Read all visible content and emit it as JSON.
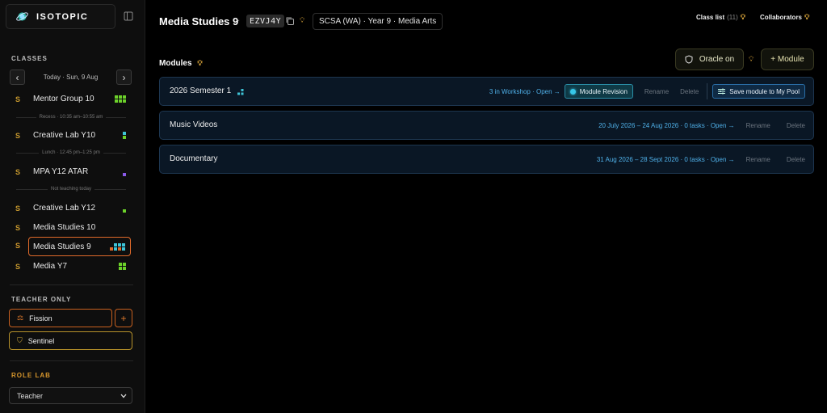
{
  "brand": {
    "name": "ISOTOPIC"
  },
  "sidebar": {
    "classes_title": "CLASSES",
    "day_label": "Today · Sun, 9 Aug",
    "prev_label": "‹",
    "next_label": "›",
    "classes": [
      {
        "badge": "S",
        "name": "Mentor Group 10"
      },
      {
        "badge": "S",
        "name": "Creative Lab Y10"
      },
      {
        "badge": "S",
        "name": "MPA Y12 ATAR"
      },
      {
        "badge": "S",
        "name": "Creative Lab Y12"
      },
      {
        "badge": "S",
        "name": "Media Studies 10"
      },
      {
        "badge": "S",
        "name": "Media Studies 9"
      },
      {
        "badge": "S",
        "name": "Media Y7"
      }
    ],
    "breaks": {
      "recess": "Recess · 10:35 am–10:55 am",
      "lunch": "Lunch · 12:45 pm–1:25 pm",
      "not_teaching": "Not teaching today"
    },
    "teacher_only_title": "TEACHER ONLY",
    "fission_label": "Fission",
    "plus_label": "+",
    "sentinel_label": "Sentinel",
    "role_lab_title": "ROLE LAB",
    "role_select_value": "Teacher"
  },
  "header": {
    "title": "Media Studies 9",
    "separator": "·",
    "class_code": "EZVJ4Y",
    "meta": "SCSA (WA) · Year 9 · Media Arts",
    "class_list_label": "Class list",
    "class_list_count": "(11)",
    "collaborators_label": "Collaborators"
  },
  "modules": {
    "title": "Modules",
    "oracle_label": "Oracle on",
    "add_module_label": "+ Module",
    "items": [
      {
        "name": "2026 Semester 1",
        "info": "3 in Workshop · Open →",
        "revision_label": "Module Revision",
        "rename_label": "Rename",
        "delete_label": "Delete",
        "save_label": "Save module to My Pool"
      },
      {
        "name": "Music Videos",
        "info": "20 July 2026 – 24 Aug 2026 · 0 tasks · Open →",
        "rename_label": "Rename",
        "delete_label": "Delete"
      },
      {
        "name": "Documentary",
        "info": "31 Aug 2026 – 28 Sept 2026 · 0 tasks · Open →",
        "rename_label": "Rename",
        "delete_label": "Delete"
      }
    ]
  },
  "colors": {
    "accent_orange": "#e06a2a",
    "accent_gold": "#d3a93a",
    "link_blue": "#4fb0e8",
    "card_bg": "#0a1725"
  }
}
